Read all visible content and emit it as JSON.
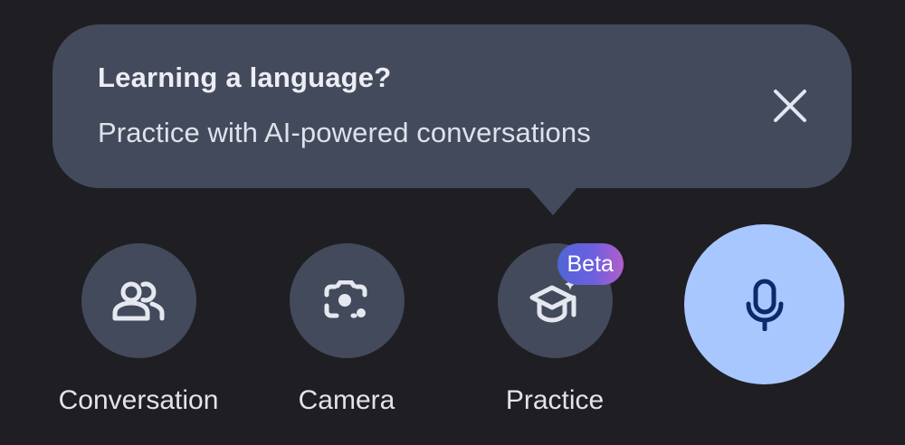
{
  "tooltip": {
    "title": "Learning a language?",
    "subtitle": "Practice with AI-powered conversations",
    "close_icon": "close-icon"
  },
  "modes": {
    "conversation": {
      "label": "Conversation",
      "icon": "people-icon"
    },
    "camera": {
      "label": "Camera",
      "icon": "lens-camera-icon"
    },
    "practice": {
      "label": "Practice",
      "icon": "graduation-cap-icon",
      "badge": "Beta"
    }
  },
  "mic": {
    "icon": "microphone-icon"
  },
  "colors": {
    "background": "#1f1f23",
    "surface": "#434a5c",
    "mic_button": "#a9c7ff",
    "mic_icon": "#0b2a6b",
    "text": "#e3e3e8"
  }
}
